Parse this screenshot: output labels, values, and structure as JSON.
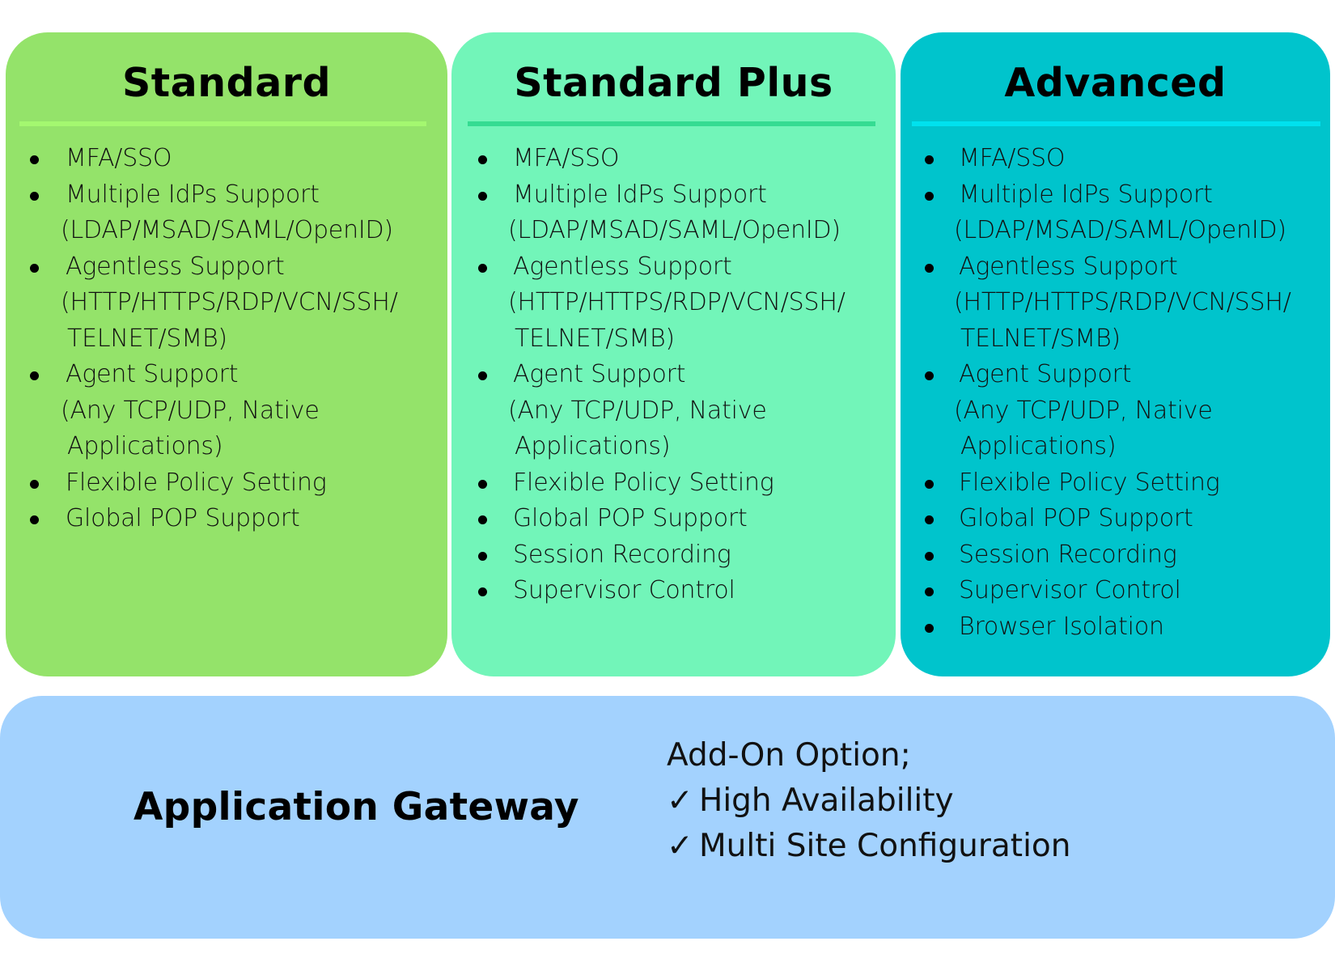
{
  "tiers": [
    {
      "name": "Standard",
      "color": "#94e36a",
      "features": [
        {
          "label": "MFA/SSO",
          "detail": []
        },
        {
          "label": "Multiple IdPs Support",
          "detail": [
            "(LDAP/MSAD/SAML/OpenID)"
          ]
        },
        {
          "label": "Agentless Support",
          "detail": [
            "(HTTP/HTTPS/RDP/VCN/SSH/",
            "TELNET/SMB)"
          ]
        },
        {
          "label": "Agent Support",
          "detail": [
            "(Any TCP/UDP, Native",
            "Applications)"
          ]
        },
        {
          "label": "Flexible Policy Setting",
          "detail": []
        },
        {
          "label": "Global POP Support",
          "detail": []
        }
      ]
    },
    {
      "name": "Standard Plus",
      "color": "#72f5b9",
      "features": [
        {
          "label": "MFA/SSO",
          "detail": []
        },
        {
          "label": "Multiple IdPs Support",
          "detail": [
            "(LDAP/MSAD/SAML/OpenID)"
          ]
        },
        {
          "label": "Agentless Support",
          "detail": [
            "(HTTP/HTTPS/RDP/VCN/SSH/",
            "TELNET/SMB)"
          ]
        },
        {
          "label": "Agent Support",
          "detail": [
            "(Any TCP/UDP, Native",
            "Applications)"
          ]
        },
        {
          "label": "Flexible Policy Setting",
          "detail": []
        },
        {
          "label": "Global POP Support",
          "detail": []
        },
        {
          "label": "Session Recording",
          "detail": []
        },
        {
          "label": "Supervisor Control",
          "detail": []
        }
      ]
    },
    {
      "name": "Advanced",
      "color": "#00c4cc",
      "features": [
        {
          "label": "MFA/SSO",
          "detail": []
        },
        {
          "label": "Multiple IdPs Support",
          "detail": [
            "(LDAP/MSAD/SAML/OpenID)"
          ]
        },
        {
          "label": "Agentless Support",
          "detail": [
            "(HTTP/HTTPS/RDP/VCN/SSH/",
            "TELNET/SMB)"
          ]
        },
        {
          "label": "Agent Support",
          "detail": [
            "(Any TCP/UDP, Native",
            "Applications)"
          ]
        },
        {
          "label": "Flexible Policy Setting",
          "detail": []
        },
        {
          "label": "Global POP Support",
          "detail": []
        },
        {
          "label": "Session Recording",
          "detail": []
        },
        {
          "label": "Supervisor Control",
          "detail": []
        },
        {
          "label": "Browser Isolation",
          "detail": []
        }
      ]
    }
  ],
  "gateway": {
    "title": "Application Gateway",
    "color": "#a3d2fe",
    "addon_label": "Add-On Option;",
    "check_glyph": "✓",
    "options": [
      "High Availability",
      "Multi Site Configuration"
    ]
  }
}
